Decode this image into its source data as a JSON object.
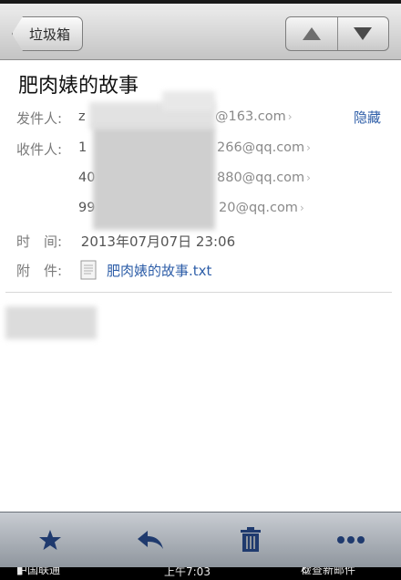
{
  "nav": {
    "back_label": "垃圾箱",
    "prev_icon": "triangle-up-icon",
    "next_icon": "triangle-down-icon"
  },
  "email": {
    "subject": "肥肉婊的故事",
    "from_label": "发件人:",
    "from_prefix": "z",
    "from_suffix": "@163.com",
    "hide_label": "隐藏",
    "to_label": "收件人:",
    "recipients": [
      {
        "prefix": "1",
        "suffix": "266@qq.com"
      },
      {
        "prefix": "40",
        "suffix": "880@qq.com"
      },
      {
        "prefix": "99",
        "suffix": "20@qq.com"
      }
    ],
    "time_label": "时　间:",
    "time_value": "2013年07月07日 23:06",
    "attach_label": "附　件:",
    "attachment_name": "肥肉婊的故事.txt"
  },
  "toolbar": {
    "icons": [
      "star-icon",
      "reply-icon",
      "trash-icon",
      "more-icon"
    ]
  },
  "status": {
    "carrier": "中国联通",
    "time": "上午7:03",
    "refresh_text": "检查新邮件"
  },
  "colors": {
    "link": "#2e5ea8",
    "toolbar_icon": "#1f3a6e"
  }
}
